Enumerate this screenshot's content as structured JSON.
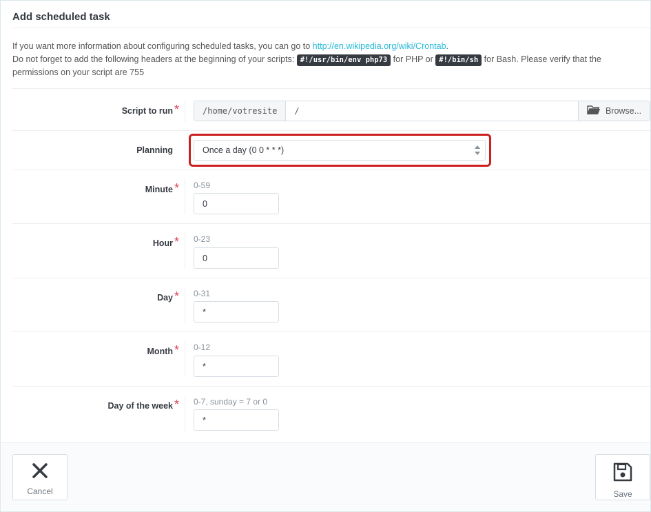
{
  "panel": {
    "title": "Add scheduled task"
  },
  "info": {
    "line1_text": "If you want more information about configuring scheduled tasks, you can go to ",
    "link_text": "http://en.wikipedia.org/wiki/Crontab",
    "line1_end": ".",
    "line2_prefix": "Do not forget to add the following headers at the beginning of your scripts: ",
    "code_php": "#!/usr/bin/env php73",
    "for_php": " for PHP or ",
    "code_sh": "#!/bin/sh",
    "for_bash": " for Bash. Please verify that the permissions on your script are 755"
  },
  "form": {
    "script": {
      "label": "Script to run",
      "prefix": "/home/votresite",
      "value": "/",
      "browse_label": "Browse..."
    },
    "planning": {
      "label": "Planning",
      "value": "Once a day (0 0 * * *)"
    },
    "minute": {
      "label": "Minute",
      "hint": "0-59",
      "value": "0"
    },
    "hour": {
      "label": "Hour",
      "hint": "0-23",
      "value": "0"
    },
    "day": {
      "label": "Day",
      "hint": "0-31",
      "value": "*"
    },
    "month": {
      "label": "Month",
      "hint": "0-12",
      "value": "*"
    },
    "weekday": {
      "label": "Day of the week",
      "hint": "0-7, sunday = 7 or 0",
      "value": "*"
    },
    "required_mark": "*"
  },
  "footer": {
    "cancel_label": "Cancel",
    "save_label": "Save"
  },
  "icons": {
    "browse": "folder-open-icon",
    "cancel": "close-icon",
    "save": "save-icon"
  },
  "colors": {
    "link": "#25b9d7",
    "required": "#e0405a",
    "highlight": "#cc1f1f",
    "code_bg": "#363a41"
  }
}
